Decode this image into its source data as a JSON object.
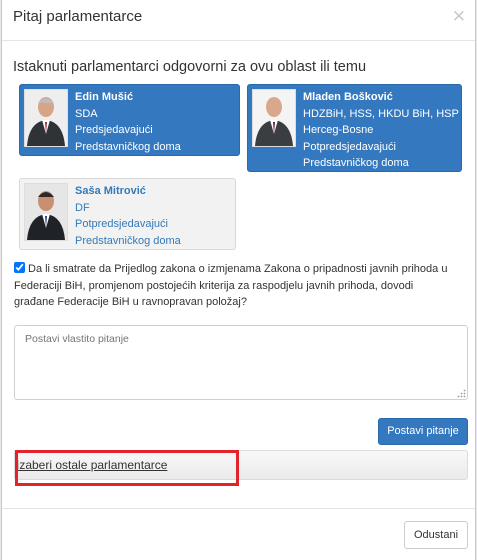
{
  "modal": {
    "title": "Pitaj parlamentarce",
    "close_glyph": "×"
  },
  "section_heading": "Istaknuti parlamentarci odgovorni za ovu oblast ili temu",
  "parliamentarians": [
    {
      "name": "Edin Mušić",
      "lines": [
        "SDA",
        "Predsjedavajući",
        "Predstavničkog doma"
      ],
      "style": "selected",
      "photo_icon": "portrait-icon"
    },
    {
      "name": "Mladen Bošković",
      "lines": [
        "HDZBiH, HSS, HKDU BiH, HSP",
        "Herceg-Bosne",
        "Potpredsjedavajući",
        "Predstavničkog doma"
      ],
      "style": "selected",
      "photo_icon": "portrait-icon"
    },
    {
      "name": "Saša Mitrović",
      "lines": [
        "DF",
        "Potpredsjedavajući",
        "Predstavničkog doma"
      ],
      "style": "unselected",
      "photo_icon": "portrait-icon"
    }
  ],
  "question": {
    "checked": true,
    "text": "Da li smatrate da Prijedlog zakona o izmjenama Zakona o pripadnosti javnih prihoda u Federaciji BiH, promjenom postojećih kriterija za raspodjelu javnih prihoda, dovodi građane Federacije BiH u ravnopravan položaj?"
  },
  "own_question": {
    "placeholder": "Postavi vlastito pitanje",
    "value": ""
  },
  "buttons": {
    "ask": "Postavi pitanje",
    "choose_others": "Izaberi ostale parlamentarce",
    "cancel": "Odustani"
  },
  "colors": {
    "accent": "#3478c0",
    "highlight": "#e3222a"
  }
}
